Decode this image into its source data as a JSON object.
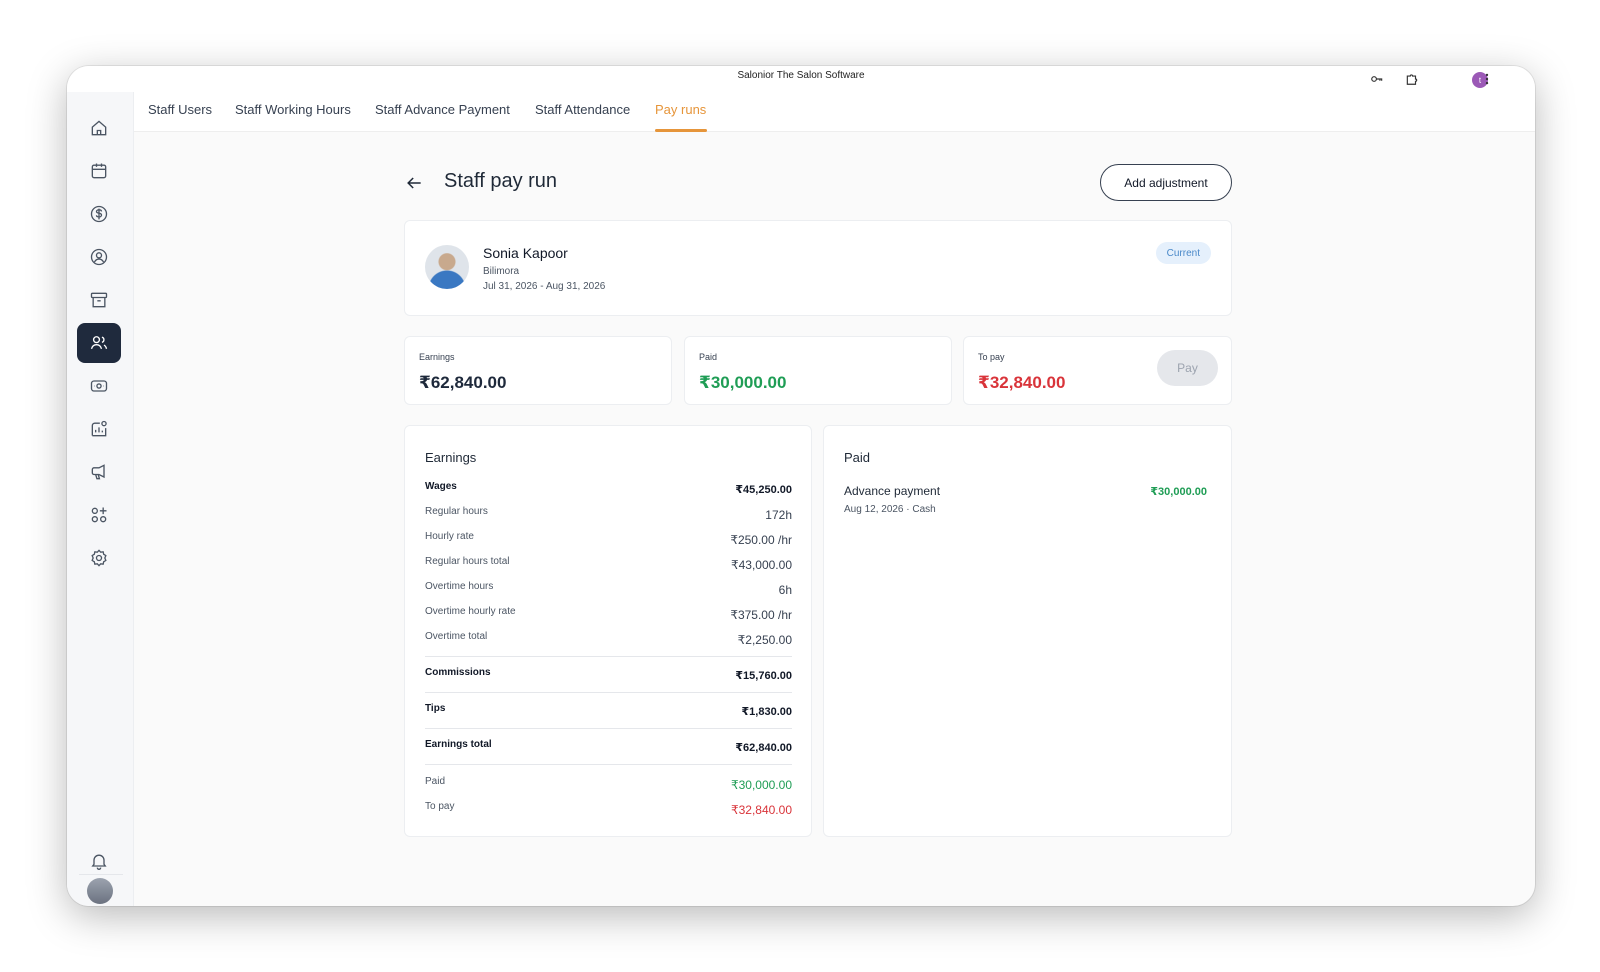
{
  "window": {
    "title": "Salonior The Salon Software",
    "user_initial": "t"
  },
  "tabs": [
    {
      "label": "Staff Users"
    },
    {
      "label": "Staff Working Hours"
    },
    {
      "label": "Staff Advance Payment"
    },
    {
      "label": "Staff Attendance"
    },
    {
      "label": "Pay runs",
      "active": true
    }
  ],
  "sidebar": {
    "items": [
      "home-icon",
      "calendar-icon",
      "dollar-icon",
      "user-circle-icon",
      "archive-icon",
      "users-icon",
      "cash-icon",
      "analytics-icon",
      "megaphone-icon",
      "apps-icon",
      "settings-icon"
    ],
    "active": "users-icon",
    "bottom": [
      "bell-icon",
      "avatar"
    ]
  },
  "page": {
    "title": "Staff pay run",
    "add_adjustment_label": "Add adjustment"
  },
  "profile": {
    "name": "Sonia Kapoor",
    "location": "Bilimora",
    "period": "Jul 31, 2026 - Aug 31, 2026",
    "status": "Current"
  },
  "stats": {
    "earnings": {
      "label": "Earnings",
      "value": "₹62,840.00"
    },
    "paid": {
      "label": "Paid",
      "value": "₹30,000.00"
    },
    "to_pay": {
      "label": "To pay",
      "value": "₹32,840.00"
    },
    "pay_label": "Pay"
  },
  "earnings": {
    "title": "Earnings",
    "wages": {
      "label": "Wages",
      "value": "₹45,250.00"
    },
    "regular_hours": {
      "label": "Regular hours",
      "value": "172h"
    },
    "hourly_rate": {
      "label": "Hourly rate",
      "value": "₹250.00 /hr"
    },
    "regular_total": {
      "label": "Regular hours total",
      "value": "₹43,000.00"
    },
    "overtime_hours": {
      "label": "Overtime hours",
      "value": "6h"
    },
    "overtime_rate": {
      "label": "Overtime hourly rate",
      "value": "₹375.00 /hr"
    },
    "overtime_total": {
      "label": "Overtime total",
      "value": "₹2,250.00"
    },
    "commissions": {
      "label": "Commissions",
      "value": "₹15,760.00"
    },
    "tips": {
      "label": "Tips",
      "value": "₹1,830.00"
    },
    "earnings_total": {
      "label": "Earnings total",
      "value": "₹62,840.00"
    },
    "paid": {
      "label": "Paid",
      "value": "₹30,000.00"
    },
    "to_pay": {
      "label": "To pay",
      "value": "₹32,840.00"
    }
  },
  "paid": {
    "title": "Paid",
    "items": [
      {
        "title": "Advance payment",
        "subtitle": "Aug 12, 2026 · Cash",
        "amount": "₹30,000.00"
      }
    ]
  },
  "colors": {
    "accent": "#e6953a",
    "green": "#1f9d55",
    "red": "#d9343a",
    "badge_bg": "#e5f0fc",
    "sidebar_active": "#1f2a3d"
  }
}
